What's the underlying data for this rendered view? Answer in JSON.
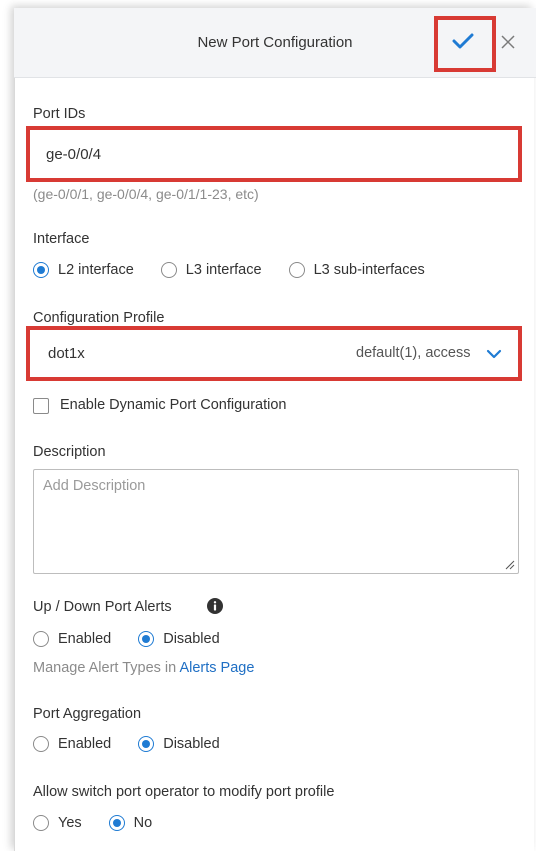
{
  "header": {
    "title": "New Port Configuration"
  },
  "port_ids": {
    "label": "Port IDs",
    "value": "ge-0/0/4",
    "hint": "(ge-0/0/1, ge-0/0/4, ge-0/1/1-23, etc)"
  },
  "interface": {
    "label": "Interface",
    "options": [
      "L2 interface",
      "L3 interface",
      "L3 sub-interfaces"
    ],
    "selected": "L2 interface"
  },
  "config_profile": {
    "label": "Configuration Profile",
    "value": "dot1x",
    "detail": "default(1), access"
  },
  "dynamic_port": {
    "label": "Enable Dynamic Port Configuration",
    "checked": false
  },
  "description": {
    "label": "Description",
    "placeholder": "Add Description"
  },
  "port_alerts": {
    "label": "Up / Down Port Alerts",
    "options": [
      "Enabled",
      "Disabled"
    ],
    "selected": "Disabled",
    "manage_text": "Manage Alert Types in ",
    "manage_link": "Alerts Page"
  },
  "port_aggregation": {
    "label": "Port Aggregation",
    "options": [
      "Enabled",
      "Disabled"
    ],
    "selected": "Disabled"
  },
  "operator_modify": {
    "label": "Allow switch port operator to modify port profile",
    "options": [
      "Yes",
      "No"
    ],
    "selected": "No"
  },
  "colors": {
    "accent": "#1f7bd3",
    "highlight": "#d83a34",
    "link": "#1f6fc4"
  }
}
